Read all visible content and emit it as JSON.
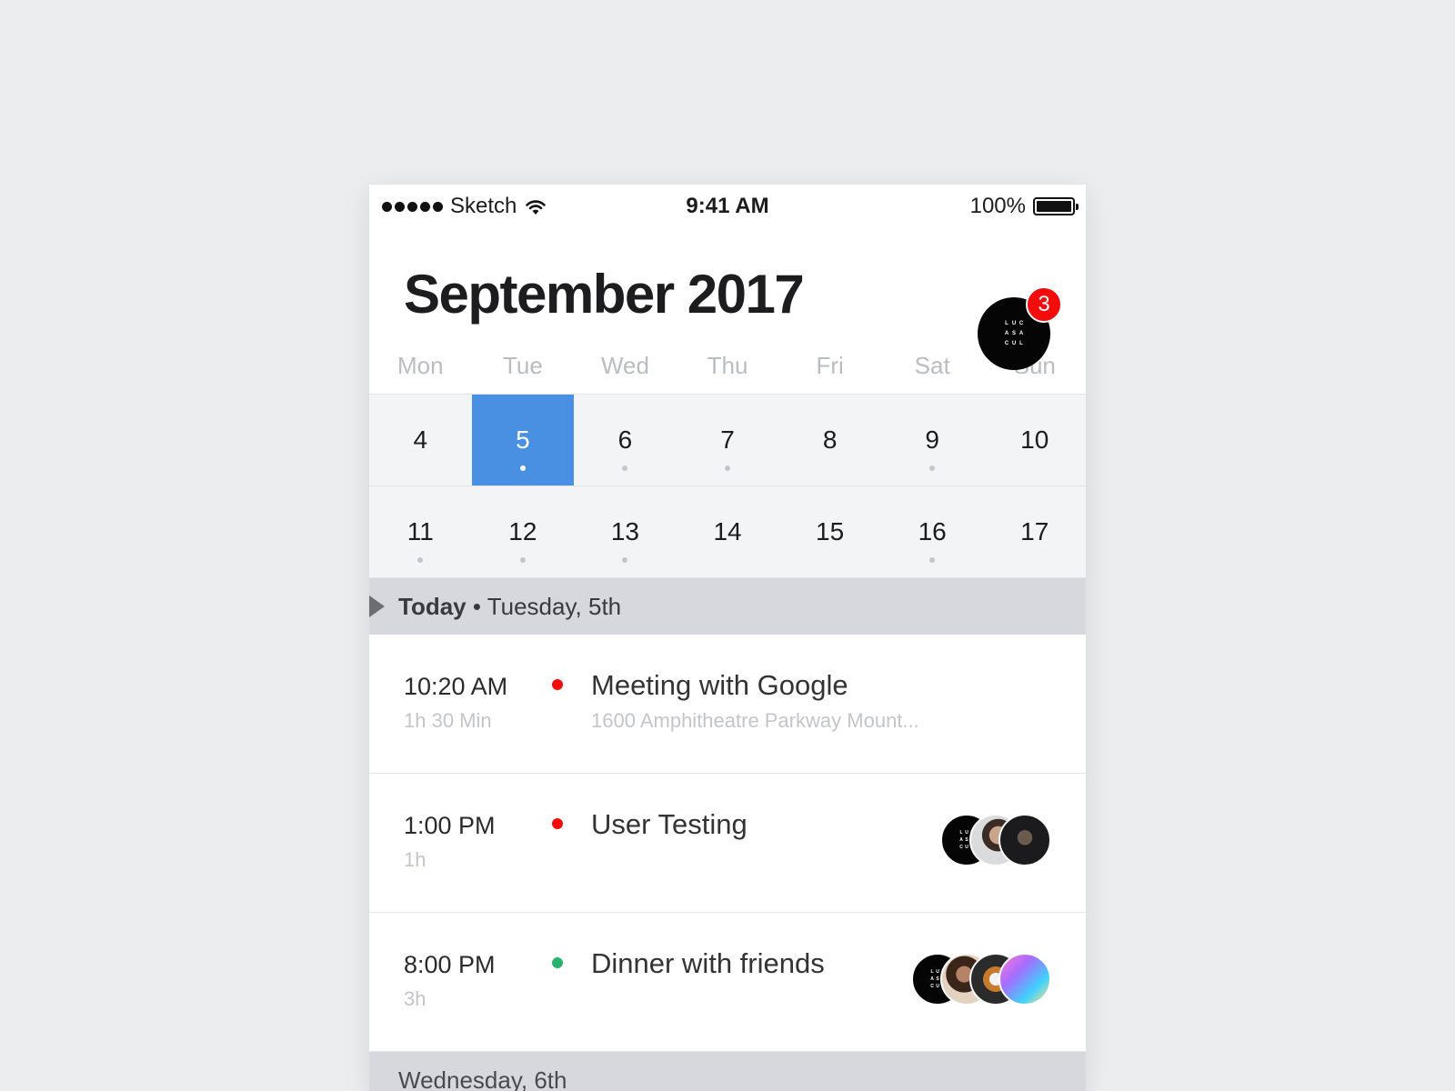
{
  "status_bar": {
    "carrier": "Sketch",
    "time": "9:41 AM",
    "battery": "100%"
  },
  "header": {
    "title": "September 2017",
    "avatar_logo": [
      "L",
      "U",
      "C",
      "A",
      "S",
      "A",
      "C",
      "U",
      "L"
    ],
    "notification_count": "3"
  },
  "calendar": {
    "weekdays": [
      "Mon",
      "Tue",
      "Wed",
      "Thu",
      "Fri",
      "Sat",
      "Sun"
    ],
    "weeks": [
      [
        {
          "day": "4",
          "dot": false
        },
        {
          "day": "5",
          "dot": true,
          "selected": true
        },
        {
          "day": "6",
          "dot": true
        },
        {
          "day": "7",
          "dot": true
        },
        {
          "day": "8",
          "dot": false
        },
        {
          "day": "9",
          "dot": true
        },
        {
          "day": "10",
          "dot": false
        }
      ],
      [
        {
          "day": "11",
          "dot": true
        },
        {
          "day": "12",
          "dot": true
        },
        {
          "day": "13",
          "dot": true
        },
        {
          "day": "14",
          "dot": false
        },
        {
          "day": "15",
          "dot": false
        },
        {
          "day": "16",
          "dot": true
        },
        {
          "day": "17",
          "dot": false
        }
      ]
    ]
  },
  "today_section": {
    "bold": "Today",
    "rest": " • Tuesday, 5th"
  },
  "events": [
    {
      "time": "10:20 AM",
      "duration": "1h 30 Min",
      "color": "#f20c0c",
      "title": "Meeting with Google",
      "location": "1600 Amphitheatre Parkway Mount..."
    },
    {
      "time": "1:00 PM",
      "duration": "1h",
      "color": "#f20c0c",
      "title": "User Testing"
    },
    {
      "time": "8:00 PM",
      "duration": "3h",
      "color": "#27b36b",
      "title": "Dinner with friends"
    }
  ],
  "next_section": {
    "label": "Wednesday, 6th"
  },
  "colors": {
    "accent": "#4a90e2",
    "badge": "#f20c0c"
  }
}
